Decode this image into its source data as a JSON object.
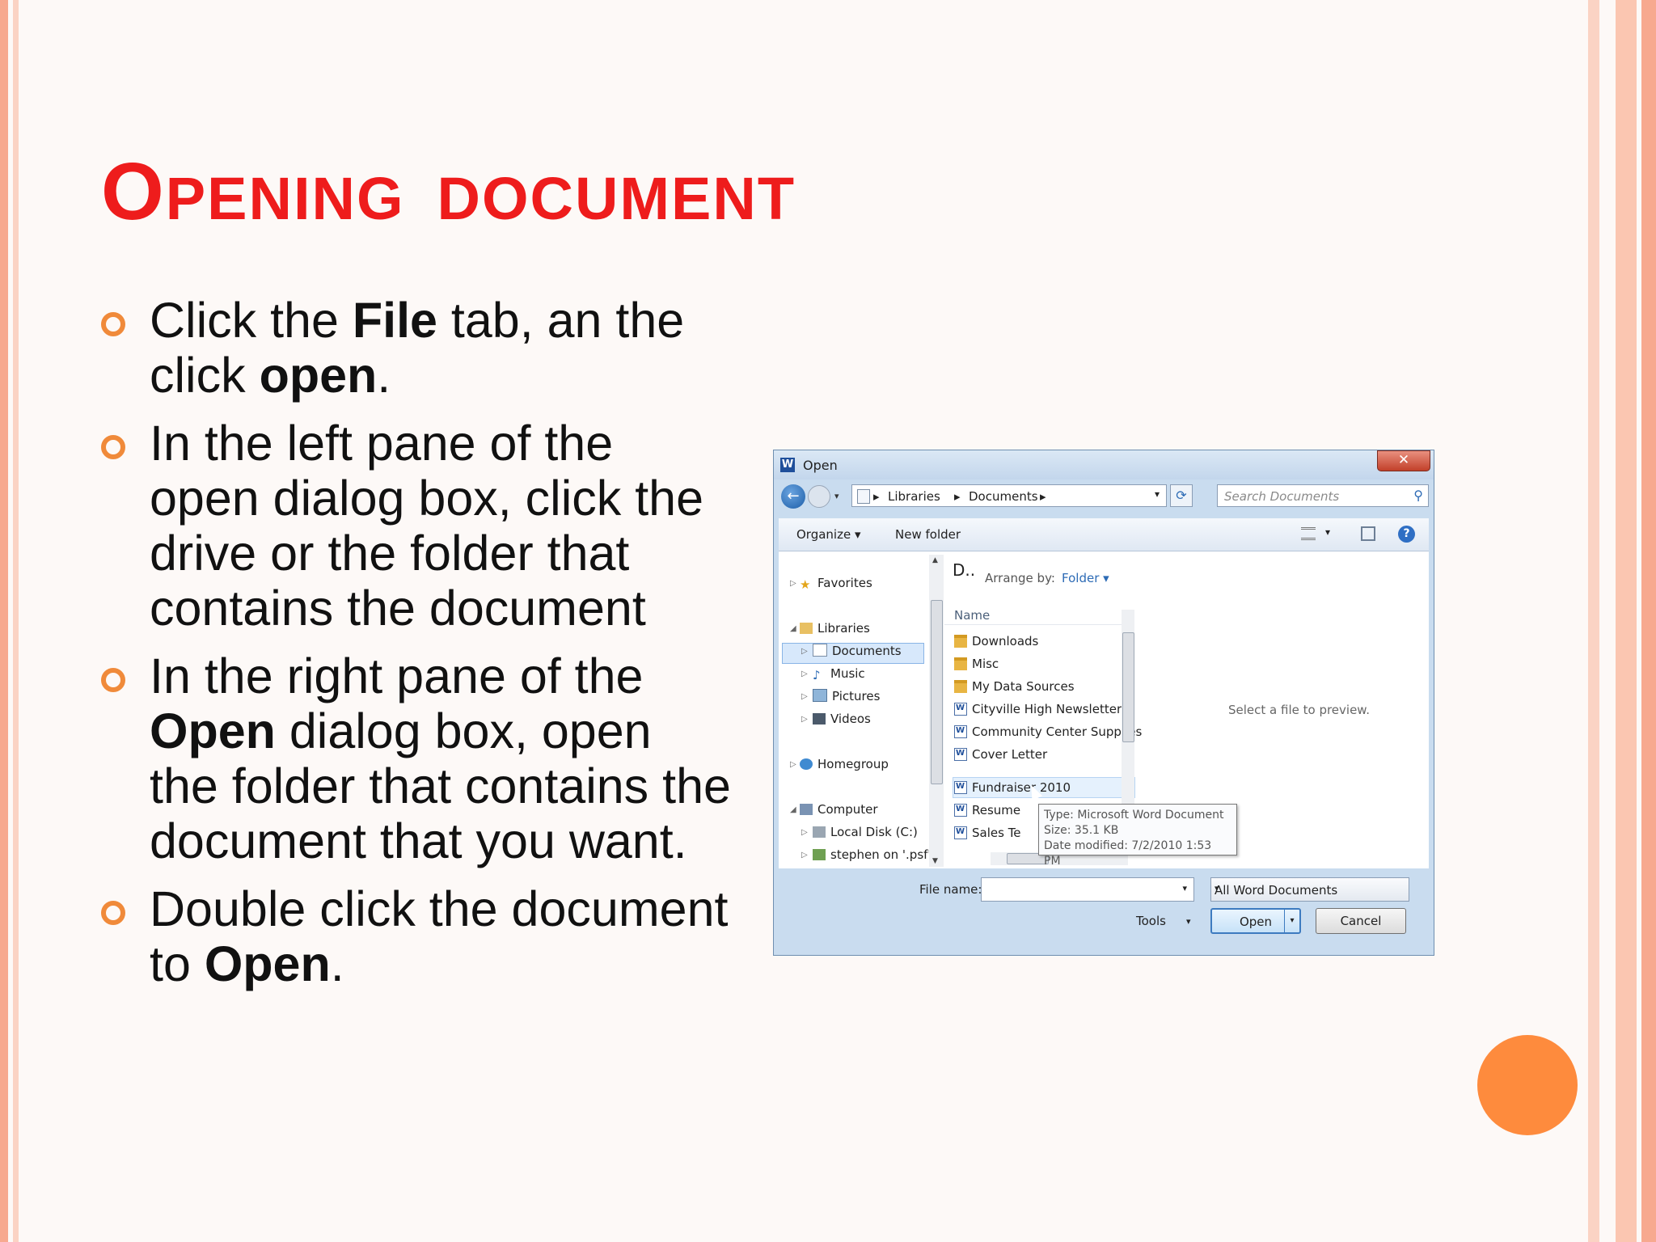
{
  "slide": {
    "title_first": "O",
    "title_rest": "PENING",
    "title_second": "DOCUMENT",
    "bullets": [
      {
        "t1": "Click the ",
        "b1": "File",
        "t2": " tab, an the click ",
        "b2": "open",
        "t3": "."
      },
      {
        "t1": "In the left pane of the open dialog box, click the drive or the folder that contains the document",
        "b1": "",
        "t2": "",
        "b2": "",
        "t3": ""
      },
      {
        "t1": "In the right pane of the ",
        "b1": "Open",
        "t2": " dialog box, open the folder that contains the document that you want.",
        "b2": "",
        "t3": ""
      },
      {
        "t1": "Double click the document to ",
        "b1": "Open",
        "t2": ".",
        "b2": "",
        "t3": ""
      }
    ],
    "colors": {
      "title": "#ee1c1c",
      "bullet": "#f08a3a",
      "accent_circle": "#fe8b3d"
    }
  },
  "dialog": {
    "title": "Open",
    "app_icon": "W",
    "close": "✕",
    "breadcrumb": [
      "Libraries",
      "Documents"
    ],
    "search_placeholder": "Search Documents",
    "toolbar": {
      "organize": "Organize ▾",
      "new_folder": "New folder"
    },
    "nav": {
      "favorites": "Favorites",
      "libraries": "Libraries",
      "documents": "Documents",
      "music": "Music",
      "pictures": "Pictures",
      "videos": "Videos",
      "homegroup": "Homegroup",
      "computer": "Computer",
      "local_disk": "Local Disk (C:)",
      "network": "stephen on '.psf'"
    },
    "library_header": "D..",
    "arrange_by": "Arrange by:",
    "arrange_value": "Folder ▾",
    "column_name": "Name",
    "files": [
      {
        "name": "Downloads",
        "icon": "folder-icon"
      },
      {
        "name": "Misc",
        "icon": "folder-icon"
      },
      {
        "name": "My Data Sources",
        "icon": "data-source-icon"
      },
      {
        "name": "Cityville High Newsletter",
        "icon": "word-doc-icon"
      },
      {
        "name": "Community Center Supplies",
        "icon": "word-doc-icon"
      },
      {
        "name": "Cover Letter",
        "icon": "word-doc-icon"
      },
      {
        "name": "Fundraiser 2010",
        "icon": "word-doc-icon"
      },
      {
        "name": "Resume",
        "icon": "word-doc-icon"
      },
      {
        "name": "Sales Te",
        "icon": "word-doc-icon"
      }
    ],
    "preview_text": "Select a file to preview.",
    "tooltip": {
      "type": "Type: Microsoft Word Document",
      "size": "Size: 35.1 KB",
      "modified": "Date modified: 7/2/2010 1:53 PM"
    },
    "file_name_label": "File name:",
    "file_name_value": "",
    "file_type": "All Word Documents",
    "tools": "Tools",
    "open_button": "Open",
    "cancel_button": "Cancel"
  }
}
